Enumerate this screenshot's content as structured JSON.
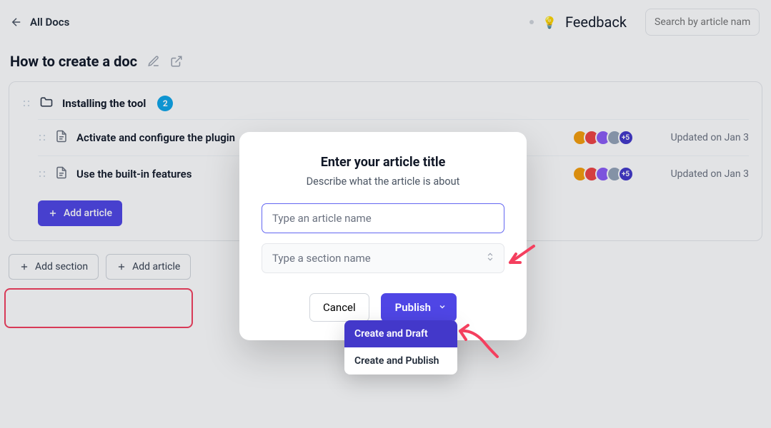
{
  "nav": {
    "back": "All Docs"
  },
  "header": {
    "feedback": "Feedback",
    "search_placeholder": "Search by article name"
  },
  "doc": {
    "title": "How to create a doc"
  },
  "section": {
    "name": "Installing the tool",
    "count": "2",
    "add_article": "Add article"
  },
  "articles": [
    {
      "name": "Activate and configure the plugin",
      "extra": "+5",
      "updated": "Updated on Jan 3"
    },
    {
      "name": "Use the built-in features",
      "extra": "+5",
      "updated": "Updated on Jan 3"
    }
  ],
  "avatar_colors": [
    "#f59e0b",
    "#ef4444",
    "#8b5cf6",
    "#94a3b8"
  ],
  "bottom": {
    "add_section": "Add section",
    "add_article": "Add article"
  },
  "modal": {
    "title": "Enter your article title",
    "subtitle": "Describe what the article is about",
    "name_placeholder": "Type an article name",
    "section_placeholder": "Type a section name",
    "cancel": "Cancel",
    "publish": "Publish"
  },
  "dropdown": {
    "draft": "Create and Draft",
    "publish": "Create and Publish"
  }
}
